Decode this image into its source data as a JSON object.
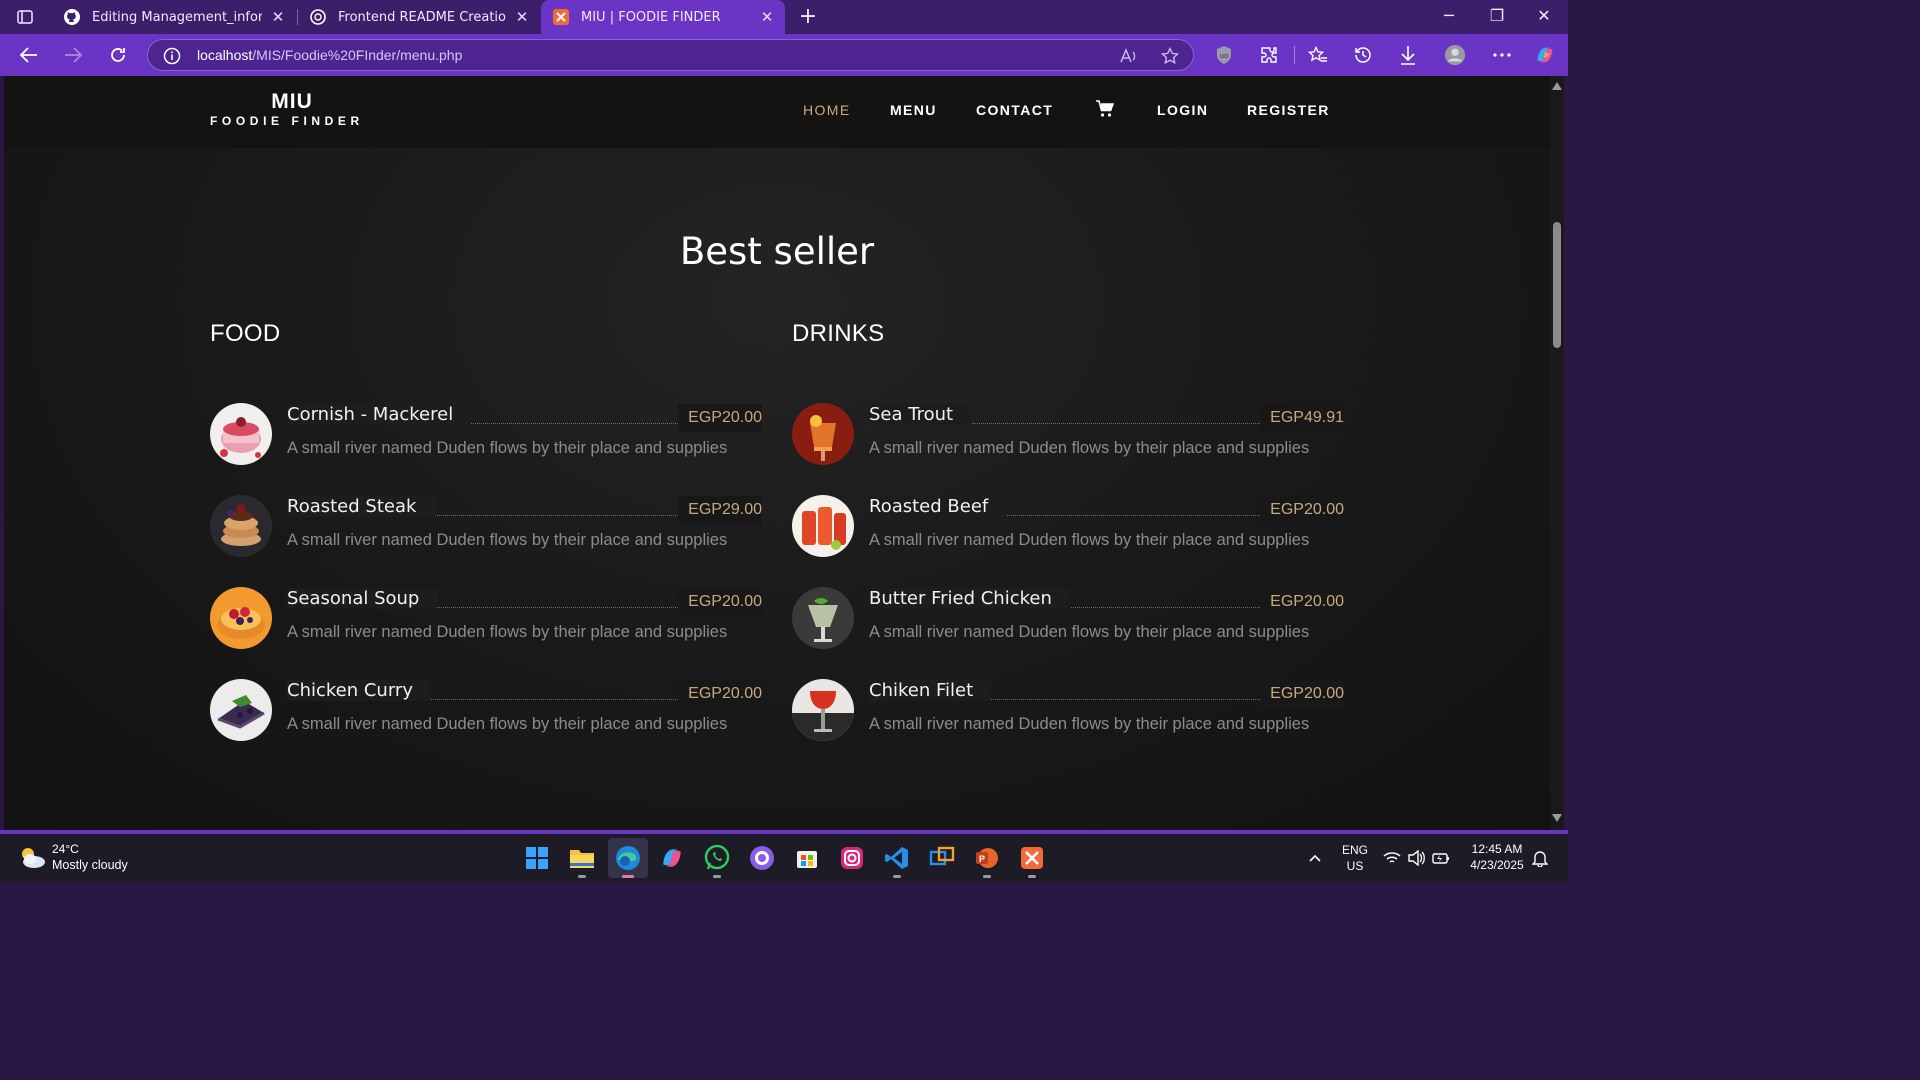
{
  "browser": {
    "tabs": [
      {
        "title": "Editing Management_information",
        "active": false
      },
      {
        "title": "Frontend README Creation",
        "active": false
      },
      {
        "title": "MIU | FOODIE FINDER",
        "active": true
      }
    ],
    "url_host": "localhost",
    "url_path": "/MIS/Foodie%20FInder/menu.php",
    "accent_color": "#6a34c4"
  },
  "site": {
    "brand_top": "MIU",
    "brand_bottom": "FOODIE FINDER",
    "nav": {
      "home": "HOME",
      "menu": "MENU",
      "contact": "CONTACT",
      "login": "LOGIN",
      "register": "REGISTER"
    },
    "section_title": "Best seller",
    "food_title": "FOOD",
    "drinks_title": "DRINKS",
    "price_color": "#c8a97e",
    "food": [
      {
        "name": "Cornish - Mackerel",
        "price": "EGP20.00",
        "desc": "A small river named Duden flows by their place and supplies"
      },
      {
        "name": "Roasted Steak",
        "price": "EGP29.00",
        "desc": "A small river named Duden flows by their place and supplies"
      },
      {
        "name": "Seasonal Soup",
        "price": "EGP20.00",
        "desc": "A small river named Duden flows by their place and supplies"
      },
      {
        "name": "Chicken Curry",
        "price": "EGP20.00",
        "desc": "A small river named Duden flows by their place and supplies"
      }
    ],
    "drinks": [
      {
        "name": "Sea Trout",
        "price": "EGP49.91",
        "desc": "A small river named Duden flows by their place and supplies"
      },
      {
        "name": "Roasted Beef",
        "price": "EGP20.00",
        "desc": "A small river named Duden flows by their place and supplies"
      },
      {
        "name": "Butter Fried Chicken",
        "price": "EGP20.00",
        "desc": "A small river named Duden flows by their place and supplies"
      },
      {
        "name": "Chiken Filet",
        "price": "EGP20.00",
        "desc": "A small river named Duden flows by their place and supplies"
      }
    ]
  },
  "taskbar": {
    "weather_temp": "24°C",
    "weather_desc": "Mostly cloudy",
    "lang_top": "ENG",
    "lang_bottom": "US",
    "time": "12:45 AM",
    "date": "4/23/2025"
  }
}
